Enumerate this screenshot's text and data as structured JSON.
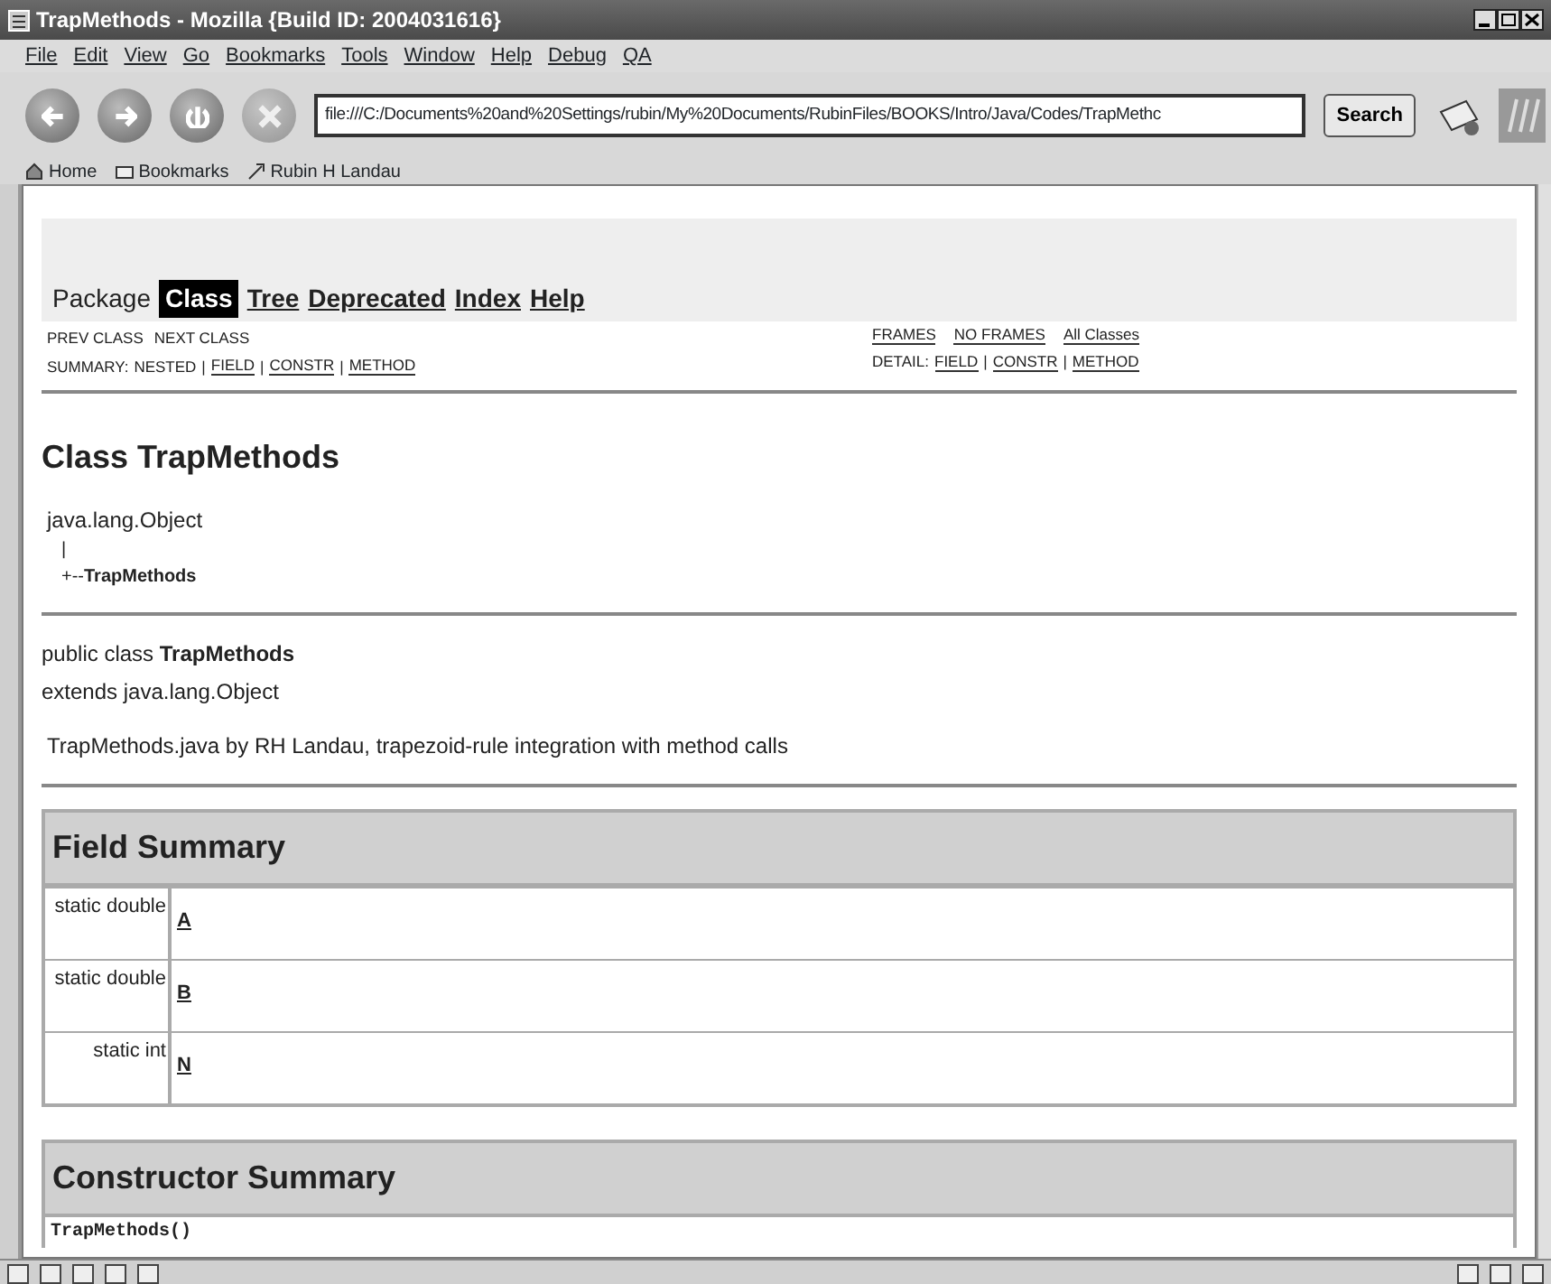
{
  "window": {
    "title": "TrapMethods - Mozilla {Build ID: 2004031616}"
  },
  "menu": [
    "File",
    "Edit",
    "View",
    "Go",
    "Bookmarks",
    "Tools",
    "Window",
    "Help",
    "Debug",
    "QA"
  ],
  "toolbar": {
    "url": "file:///C:/Documents%20and%20Settings/rubin/My%20Documents/RubinFiles/BOOKS/Intro/Java/Codes/TrapMethc",
    "search_label": "Search"
  },
  "personal_bar": [
    {
      "label": "Home",
      "kind": "home"
    },
    {
      "label": "Bookmarks",
      "kind": "folder"
    },
    {
      "label": "Rubin H Landau",
      "kind": "bookmark"
    }
  ],
  "doc": {
    "navbar": [
      {
        "label": "Package",
        "selected": false,
        "link": false
      },
      {
        "label": "Class",
        "selected": true,
        "link": false
      },
      {
        "label": "Tree",
        "selected": false,
        "link": true
      },
      {
        "label": "Deprecated",
        "selected": false,
        "link": true
      },
      {
        "label": "Index",
        "selected": false,
        "link": true
      },
      {
        "label": "Help",
        "selected": false,
        "link": true
      }
    ],
    "prev_next": [
      "PREV CLASS",
      "NEXT CLASS"
    ],
    "frames": [
      {
        "text": "FRAMES",
        "link": true
      },
      {
        "text": "NO FRAMES",
        "link": true
      },
      {
        "text": "All Classes",
        "link": true
      }
    ],
    "summary": [
      {
        "text": "SUMMARY:",
        "link": false
      },
      {
        "text": "NESTED",
        "link": false
      },
      {
        "text": "|",
        "link": false
      },
      {
        "text": "FIELD",
        "link": true
      },
      {
        "text": "|",
        "link": false
      },
      {
        "text": "CONSTR",
        "link": true
      },
      {
        "text": "|",
        "link": false
      },
      {
        "text": "METHOD",
        "link": true
      }
    ],
    "detail": [
      {
        "text": "DETAIL:",
        "link": false
      },
      {
        "text": "FIELD",
        "link": true
      },
      {
        "text": "|",
        "link": false
      },
      {
        "text": "CONSTR",
        "link": true
      },
      {
        "text": "|",
        "link": false
      },
      {
        "text": "METHOD",
        "link": true
      }
    ],
    "heading": "Class TrapMethods",
    "hierarchy": [
      "java.lang.Object",
      "|",
      "+--**TrapMethods**"
    ],
    "declaration": [
      "public class **TrapMethods**",
      "extends java.lang.Object"
    ],
    "description": "TrapMethods.java by RH Landau, trapezoid-rule integration with method calls",
    "field_summary": {
      "title": "Field Summary",
      "rows": [
        {
          "type": "static double",
          "name": "A"
        },
        {
          "type": "static double",
          "name": "B"
        },
        {
          "type": "static int",
          "name": "N"
        }
      ]
    },
    "constructor_summary": {
      "title": "Constructor Summary",
      "rows": [
        {
          "name": "TrapMethods()"
        }
      ]
    }
  }
}
